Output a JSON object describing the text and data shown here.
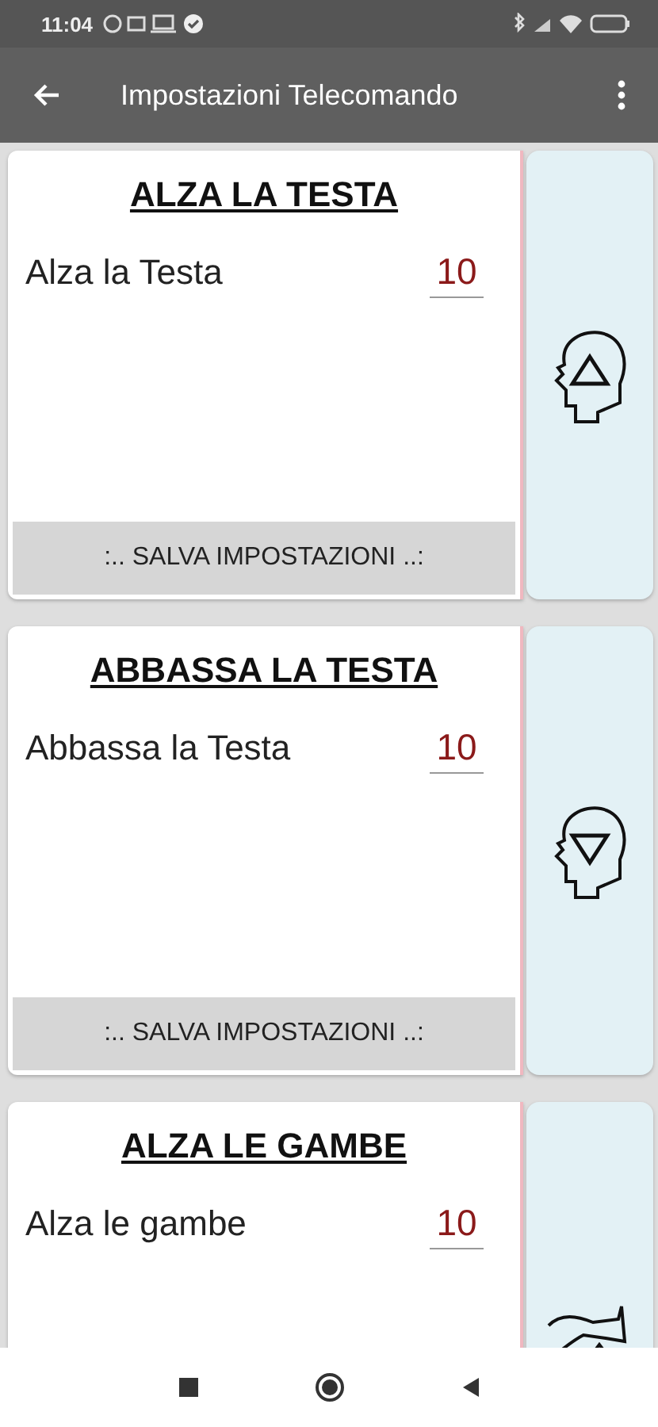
{
  "status_bar": {
    "time": "11:04"
  },
  "app_bar": {
    "title": "Impostazioni Telecomando"
  },
  "cards": [
    {
      "title": "ALZA LA TESTA",
      "label": "Alza la Testa",
      "value": "10",
      "save_button": ":.. SALVA IMPOSTAZIONI ..:",
      "kind": "head-up"
    },
    {
      "title": "ABBASSA LA TESTA",
      "label": "Abbassa la Testa",
      "value": "10",
      "save_button": ":.. SALVA IMPOSTAZIONI ..:",
      "kind": "head-down"
    },
    {
      "title": "ALZA LE GAMBE",
      "label": "Alza le gambe",
      "value": "10",
      "kind": "legs-up"
    }
  ]
}
